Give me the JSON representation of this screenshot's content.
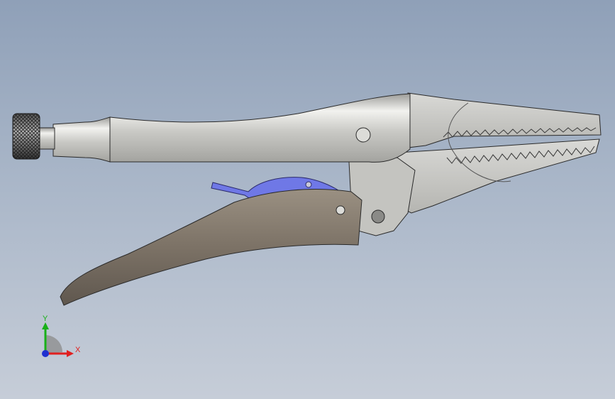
{
  "viewport": {
    "background_top": "#8fa0b8",
    "background_bottom": "#c6cdd8"
  },
  "model": {
    "name_icon": "locking-pliers-model",
    "colors": {
      "steel_light": "#e6e6e3",
      "steel_mid": "#bdbdb9",
      "steel_dark": "#7f7f7c",
      "handle_grip": "#7e7468",
      "handle_grip_dark": "#5b544c",
      "release_lever": "#6f78e6",
      "outline": "#2a2a2a"
    }
  },
  "triad": {
    "x_label": "X",
    "y_label": "Y",
    "x_color": "#e02020",
    "y_color": "#18b018",
    "z_color": "#2030d0"
  }
}
